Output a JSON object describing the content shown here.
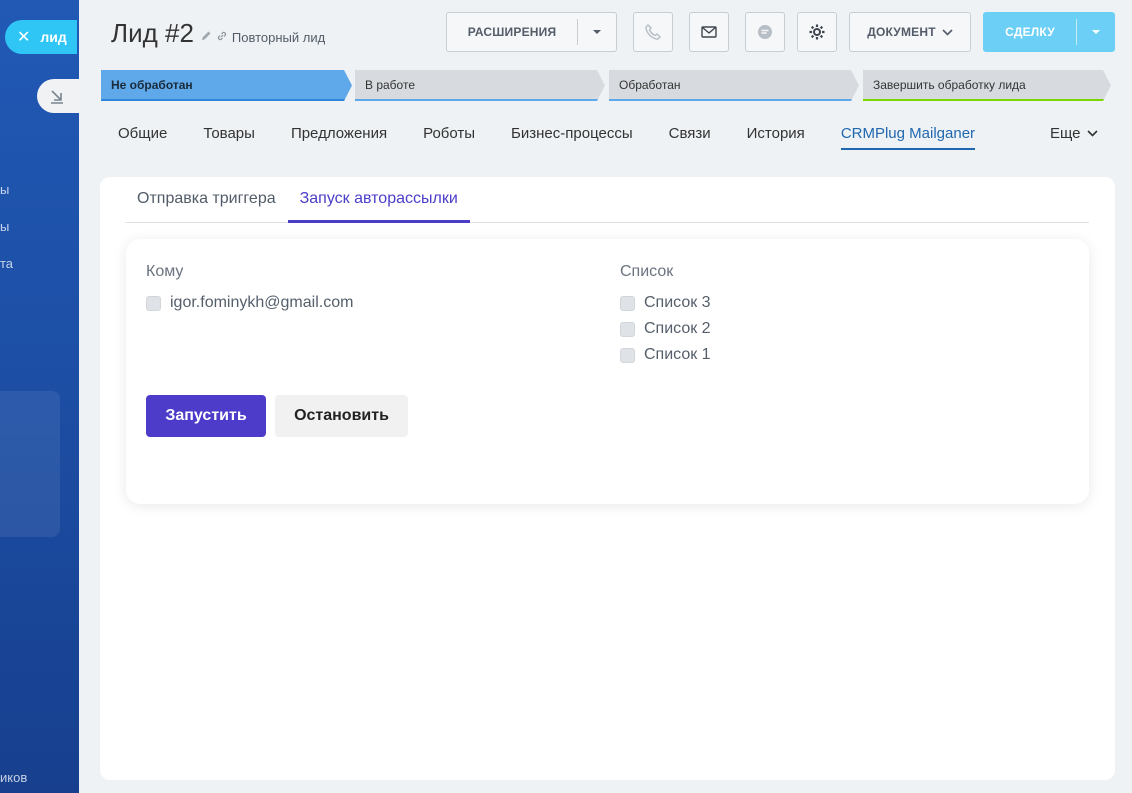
{
  "backdrop": {
    "close_label": "лид",
    "ghost_texts": [
      "ы",
      "ы",
      "та",
      "иков"
    ]
  },
  "header": {
    "title": "Лид #2",
    "subtitle": "Повторный лид",
    "extensions_label": "РАСШИРЕНИЯ",
    "document_label": "ДОКУМЕНТ",
    "deal_label": "СДЕЛКУ"
  },
  "stages": [
    {
      "label": "Не обработан"
    },
    {
      "label": "В работе"
    },
    {
      "label": "Обработан"
    },
    {
      "label": "Завершить обработку лида"
    }
  ],
  "tabs": [
    {
      "label": "Общие"
    },
    {
      "label": "Товары"
    },
    {
      "label": "Предложения"
    },
    {
      "label": "Роботы"
    },
    {
      "label": "Бизнес-процессы"
    },
    {
      "label": "Связи"
    },
    {
      "label": "История"
    },
    {
      "label": "CRMPlug Mailganer"
    }
  ],
  "more_tab": "Еще",
  "subtabs": [
    {
      "label": "Отправка триггера"
    },
    {
      "label": "Запуск авторассылки"
    }
  ],
  "form": {
    "to_label": "Кому",
    "recipients": [
      "igor.fominykh@gmail.com"
    ],
    "list_label": "Список",
    "lists": [
      "Список 3",
      "Список 2",
      "Список 1"
    ],
    "start_label": "Запустить",
    "stop_label": "Остановить"
  },
  "colors": {
    "accent": "#4c3cc9",
    "deal_button": "#6ccff6",
    "active_stage": "#5fa9ea",
    "tab_active": "#2067b0",
    "sidebar": "#1d4fa6"
  }
}
